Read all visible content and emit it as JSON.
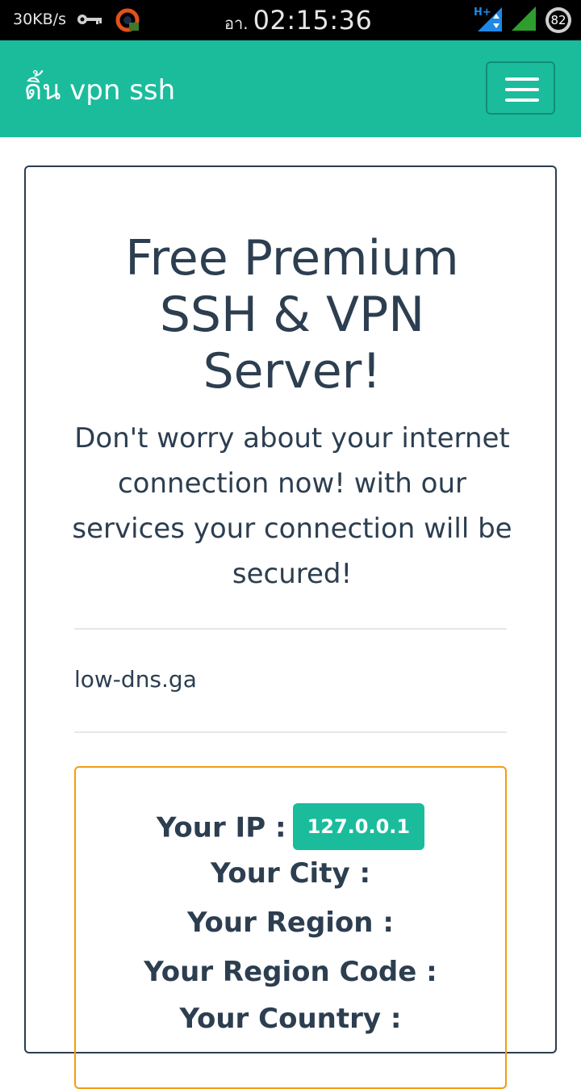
{
  "status_bar": {
    "net_speed": "30KB/s",
    "ampm": "อา.",
    "time": "02:15:36",
    "network_type": "H+",
    "battery": "82",
    "icons": [
      "key-icon",
      "vpn-icon",
      "hplus-network-icon",
      "signal-icon",
      "battery-icon"
    ]
  },
  "navbar": {
    "brand": "ดิ้น vpn ssh",
    "menu_icon": "hamburger-menu-icon",
    "bg_color": "#1abc9c"
  },
  "hero": {
    "title": "Free Premium SSH & VPN Server!",
    "lead": "Don't worry about your internet connection now! with our services your connection will be secured!"
  },
  "domain_text": "low-dns.ga",
  "info": {
    "ip_label": "Your IP :",
    "ip_value": "127.0.0.1",
    "city_label": "Your City :",
    "region_label": "Your Region :",
    "region_code_label": "Your Region Code :",
    "country_label": "Your Country :"
  },
  "colors": {
    "accent": "#1abc9c",
    "text": "#2c3e50",
    "info_border": "#f39c12"
  }
}
